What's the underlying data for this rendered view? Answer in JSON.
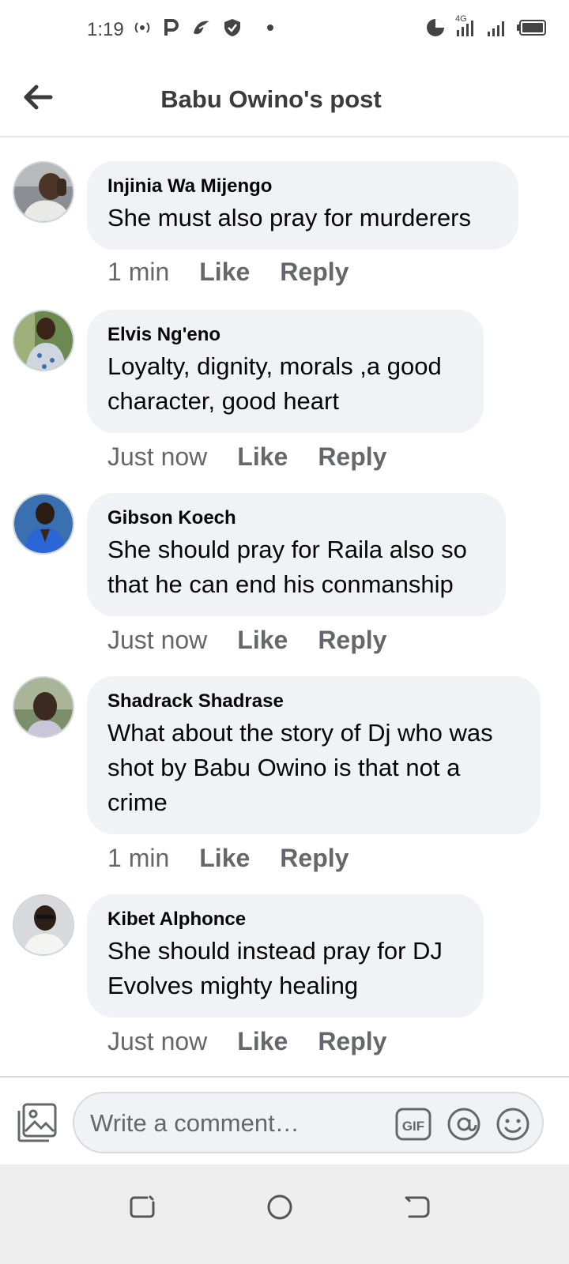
{
  "status_bar": {
    "time": "1:19",
    "network": "4G"
  },
  "header": {
    "title": "Babu Owino's post",
    "back_icon": "arrow-left-icon"
  },
  "comments": [
    {
      "author": "Injinia Wa Mijengo",
      "text": "She must also pray for murderers",
      "time": "1 min",
      "like_label": "Like",
      "reply_label": "Reply"
    },
    {
      "author": "Elvis Ng'eno",
      "text": "Loyalty, dignity, morals ,a good character, good heart",
      "time": "Just now",
      "like_label": "Like",
      "reply_label": "Reply"
    },
    {
      "author": "Gibson Koech",
      "text": "She should pray for Raila also so that he can end his conmanship",
      "time": "Just now",
      "like_label": "Like",
      "reply_label": "Reply"
    },
    {
      "author": "Shadrack Shadrase",
      "text": "What about the story of Dj who was shot by Babu Owino is that not a crime",
      "time": "1 min",
      "like_label": "Like",
      "reply_label": "Reply"
    },
    {
      "author": "Kibet Alphonce",
      "text": "She should instead pray for DJ Evolves mighty healing",
      "time": "Just now",
      "like_label": "Like",
      "reply_label": "Reply"
    }
  ],
  "composer": {
    "placeholder": "Write a comment…",
    "value": "",
    "gif_label": "GIF",
    "icons": [
      "photo-icon",
      "gif-icon",
      "mention-icon",
      "emoji-icon"
    ]
  },
  "nav_bar": {
    "icons": [
      "recents-icon",
      "home-icon",
      "back-icon"
    ]
  },
  "colors": {
    "bubble": "#f0f2f5",
    "meta_text": "#65676b",
    "title": "#3a3b3c",
    "nav_bar": "#eeeeee"
  }
}
